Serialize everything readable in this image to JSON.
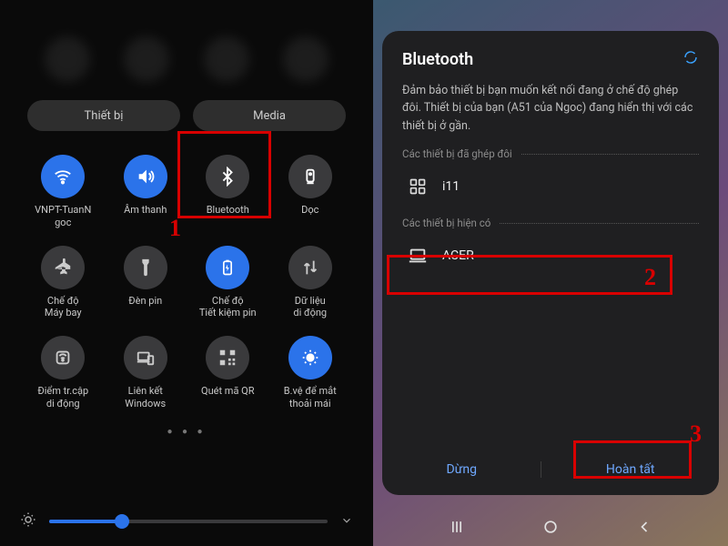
{
  "left": {
    "tabs": {
      "device": "Thiết bị",
      "media": "Media"
    },
    "tiles": [
      {
        "label": "VNPT-TuanN\ngoc",
        "icon": "wifi",
        "active": true
      },
      {
        "label": "Âm thanh",
        "icon": "sound",
        "active": true
      },
      {
        "label": "Bluetooth",
        "icon": "bluetooth",
        "active": false
      },
      {
        "label": "Dọc",
        "icon": "rotation",
        "active": false
      },
      {
        "label": "Chế độ\nMáy bay",
        "icon": "airplane",
        "active": false
      },
      {
        "label": "Đèn pin",
        "icon": "flashlight",
        "active": false
      },
      {
        "label": "Chế độ\nTiết kiệm pin",
        "icon": "battery",
        "active": true
      },
      {
        "label": "Dữ liệu\ndi động",
        "icon": "mobiledata",
        "active": false
      },
      {
        "label": "Điểm tr.cập\ndi động",
        "icon": "hotspot",
        "active": false
      },
      {
        "label": "Liên kết\nWindows",
        "icon": "link",
        "active": false
      },
      {
        "label": "Quét mã QR",
        "icon": "qr",
        "active": false
      },
      {
        "label": "B.vệ để mắt\nthoải mái",
        "icon": "eye",
        "active": true
      }
    ],
    "brightness_pct": 26
  },
  "right": {
    "title": "Bluetooth",
    "desc": "Đảm bảo thiết bị bạn muốn kết nối đang ở chế độ ghép đôi. Thiết bị của bạn (A51 của Ngoc) đang hiển thị với các thiết bị ở gần.",
    "paired_label": "Các thiết bị đã ghép đôi",
    "paired": [
      {
        "name": "i11",
        "icon": "grid"
      }
    ],
    "avail_label": "Các thiết bị hiện có",
    "avail": [
      {
        "name": "ACER",
        "icon": "laptop"
      }
    ],
    "actions": {
      "stop": "Dừng",
      "done": "Hoàn tất"
    }
  },
  "annotations": {
    "n1": "1",
    "n2": "2",
    "n3": "3"
  }
}
